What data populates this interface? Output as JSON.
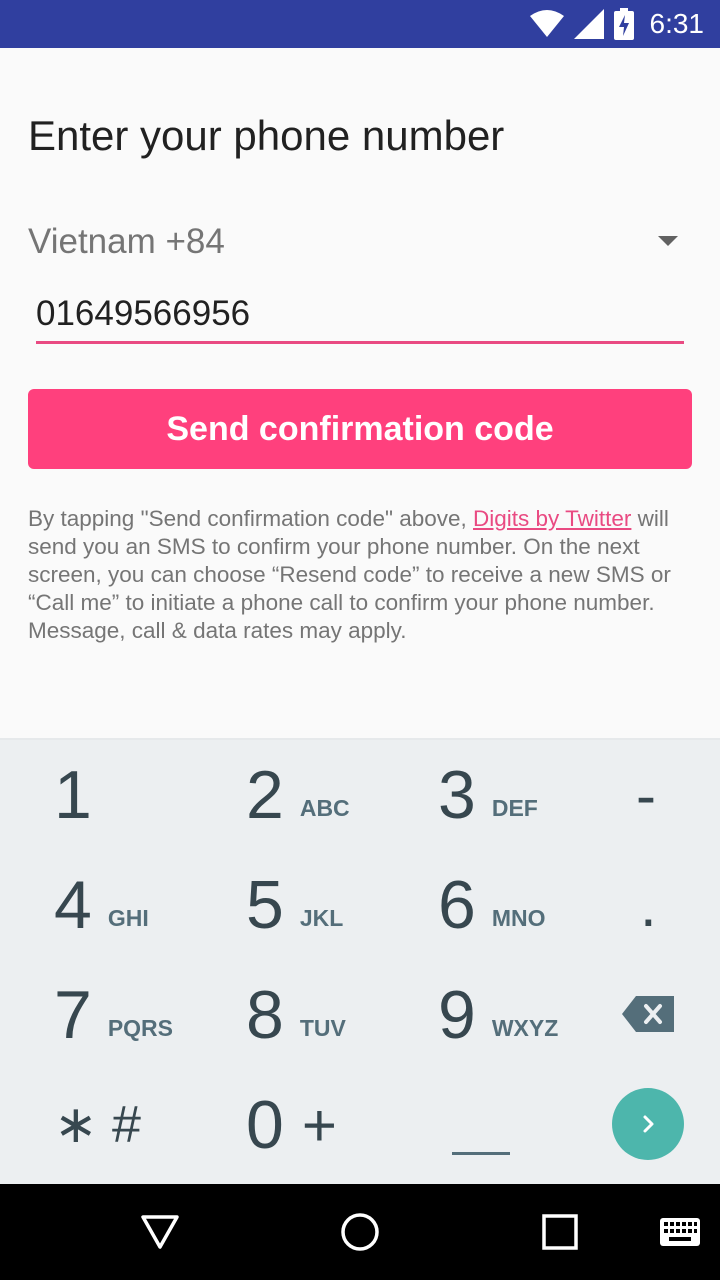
{
  "status_bar": {
    "time": "6:31",
    "icons": [
      "wifi-icon",
      "signal-icon",
      "battery-charging-icon"
    ],
    "background": "#303f9f"
  },
  "screen": {
    "title": "Enter your phone number",
    "country_selector": {
      "value": "Vietnam +84",
      "icon": "dropdown-arrow-icon"
    },
    "phone_input": {
      "value": "01649566956"
    },
    "send_button": {
      "label": "Send confirmation code",
      "color": "#ff407d"
    },
    "disclaimer": {
      "prefix": "By tapping \"Send confirmation code\" above, ",
      "link": "Digits by Twitter",
      "suffix": " will send you an SMS to confirm your phone number. On the next screen, you can choose “Resend code” to receive a new SMS or “Call me” to initiate a phone call to confirm your phone number. Message, call & data rates may apply."
    }
  },
  "keypad": {
    "keys": [
      {
        "digit": "1",
        "letters": ""
      },
      {
        "digit": "2",
        "letters": "ABC"
      },
      {
        "digit": "3",
        "letters": "DEF"
      },
      {
        "digit": "4",
        "letters": "GHI"
      },
      {
        "digit": "5",
        "letters": "JKL"
      },
      {
        "digit": "6",
        "letters": "MNO"
      },
      {
        "digit": "7",
        "letters": "PQRS"
      },
      {
        "digit": "8",
        "letters": "TUV"
      },
      {
        "digit": "9",
        "letters": "WXYZ"
      },
      {
        "digit": "0",
        "letters": "+"
      }
    ],
    "star_hash": "∗ #",
    "dash": "-",
    "dot": ".",
    "icons": [
      "backspace-icon",
      "next-icon",
      "space-icon"
    ],
    "accent": "#4db6ac"
  },
  "nav_bar": {
    "icons": [
      "back-icon",
      "home-icon",
      "recents-icon",
      "keyboard-icon"
    ]
  }
}
